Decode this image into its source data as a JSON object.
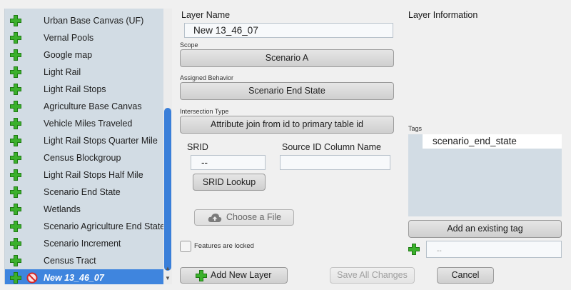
{
  "layers": [
    {
      "label": "Urban Base Canvas (UF)"
    },
    {
      "label": "Vernal Pools"
    },
    {
      "label": "Google map"
    },
    {
      "label": "Light Rail"
    },
    {
      "label": "Light Rail Stops"
    },
    {
      "label": "Agriculture Base Canvas"
    },
    {
      "label": "Vehicle Miles Traveled"
    },
    {
      "label": "Light Rail Stops Quarter Mile"
    },
    {
      "label": "Census Blockgroup"
    },
    {
      "label": "Light Rail Stops Half Mile"
    },
    {
      "label": "Scenario End State"
    },
    {
      "label": "Wetlands"
    },
    {
      "label": "Scenario Agriculture End State"
    },
    {
      "label": "Scenario Increment"
    },
    {
      "label": "Census Tract"
    },
    {
      "label": "New 13_46_07",
      "selected": true
    }
  ],
  "form": {
    "layer_name_label": "Layer Name",
    "layer_name_value": "New 13_46_07",
    "scope_label": "Scope",
    "scope_value": "Scenario A",
    "assigned_behavior_label": "Assigned Behavior",
    "assigned_behavior_value": "Scenario End State",
    "intersection_type_label": "Intersection Type",
    "intersection_type_value": "Attribute join from id to primary table id",
    "srid_label": "SRID",
    "srid_value": "--",
    "source_id_label": "Source ID Column Name",
    "source_id_value": "",
    "srid_lookup_label": "SRID Lookup",
    "choose_file_label": "Choose a File",
    "features_locked_label": "Features are locked"
  },
  "info": {
    "title": "Layer Information",
    "tags_label": "Tags",
    "tags": [
      "scenario_end_state"
    ],
    "add_tag_label": "Add an existing tag",
    "new_tag_placeholder": "--"
  },
  "footer": {
    "add_new_layer_label": "Add New Layer",
    "save_all_label": "Save All Changes",
    "cancel_label": "Cancel"
  },
  "colors": {
    "accent": "#3f85de",
    "plus_green": "#3bb02c",
    "panel_bg": "#d2dce4"
  },
  "icons": [
    "plus-icon",
    "no-entry-icon",
    "cloud-upload-icon"
  ]
}
